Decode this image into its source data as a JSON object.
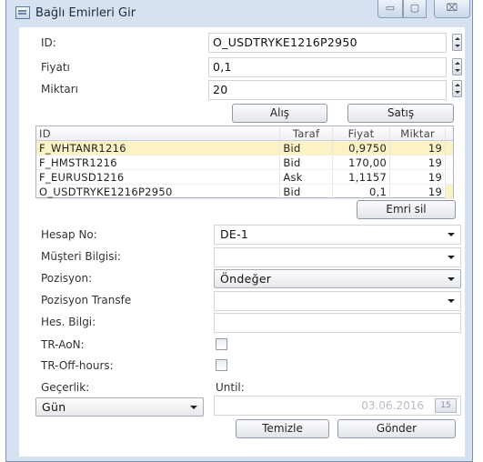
{
  "window": {
    "title": "Bağlı Emirleri Gir",
    "buttons": {
      "minimize": "▭",
      "maximize": "▢",
      "close": "⌧"
    }
  },
  "form": {
    "id_label": "ID:",
    "id_value": "O_USDTRYKE1216P2950",
    "price_label": "Fiyatı",
    "price_value": "0,1",
    "qty_label": "Miktarı",
    "qty_value": "20"
  },
  "side_buttons": {
    "buy": "Alış",
    "sell": "Satış"
  },
  "orders_table": {
    "columns": [
      "ID",
      "Taraf",
      "Fiyat",
      "Miktar"
    ],
    "rows": [
      {
        "id": "F_WHTANR1216",
        "side": "Bid",
        "price": "0,9750",
        "qty": "19"
      },
      {
        "id": "F_HMSTR1216",
        "side": "Bid",
        "price": "170,00",
        "qty": "19"
      },
      {
        "id": "F_EURUSD1216",
        "side": "Ask",
        "price": "1,1157",
        "qty": "19"
      },
      {
        "id": "O_USDTRYKE1216P2950",
        "side": "Bid",
        "price": "0,1",
        "qty": "19"
      }
    ]
  },
  "delete_order_button": "Emri sil",
  "account": {
    "account_no_label": "Hesap No:",
    "account_no_value": "DE-1",
    "customer_info_label": "Müşteri Bilgisi:",
    "customer_info_value": "",
    "position_label": "Pozisyon:",
    "position_value": "Öndeğer",
    "position_transfer_label": "Pozisyon Transfe",
    "position_transfer_value": "",
    "account_info_label": "Hes. Bilgi:",
    "account_info_value": ""
  },
  "flags": {
    "tr_aon_label": "TR-AoN:",
    "tr_offhours_label": "TR-Off-hours:"
  },
  "validity": {
    "label": "Geçerlik:",
    "until_label": "Until:",
    "selected": "Gün",
    "date": "03.06.2016",
    "calendar_glyph": "15"
  },
  "actions": {
    "clear": "Temizle",
    "send": "Gönder"
  }
}
